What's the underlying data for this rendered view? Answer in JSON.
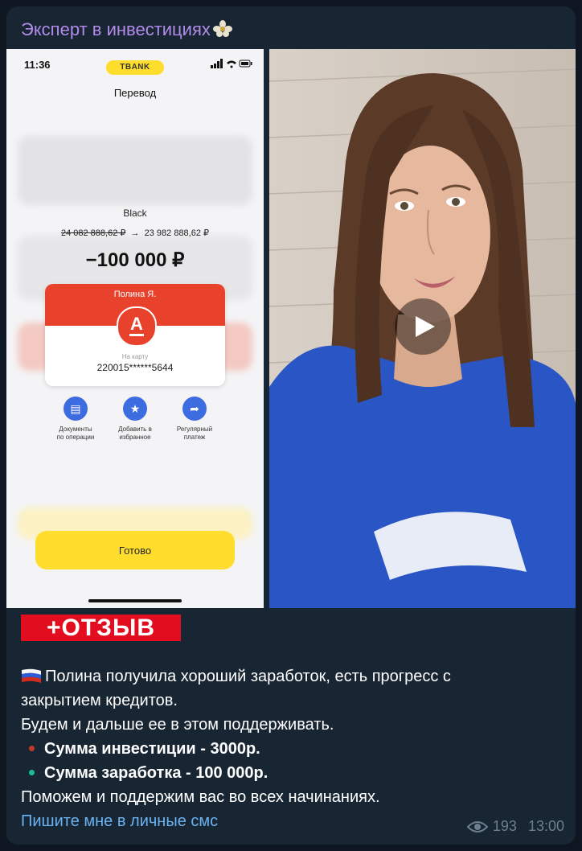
{
  "channel": {
    "name": "Эксперт в инвестициях"
  },
  "phone": {
    "status_time": "11:36",
    "bank_pill": "TBANK",
    "page_title": "Перевод",
    "account_name": "Black",
    "balance_before": "24 082 888,62 ₽",
    "arrow": "→",
    "balance_after": "23 982 888,62 ₽",
    "amount": "−100 000 ₽",
    "recipient": {
      "name": "Полина Я.",
      "bank_letter": "А",
      "card_label": "На карту",
      "card_number": "220015******5644"
    },
    "actions": [
      {
        "icon": "document-icon",
        "glyph": "▤",
        "label_line1": "Документы",
        "label_line2": "по операции"
      },
      {
        "icon": "star-icon",
        "glyph": "★",
        "label_line1": "Добавить в",
        "label_line2": "избранное"
      },
      {
        "icon": "repeat-icon",
        "glyph": "➦",
        "label_line1": "Регулярный",
        "label_line2": "платеж"
      }
    ],
    "done_label": "Готово"
  },
  "message": {
    "badge": "+ОТЗЫВ",
    "line1": "Полина получила хороший заработок, есть прогресс с",
    "line2": "закрытием кредитов.",
    "line3": "Будем и дальше ее в этом поддерживать.",
    "bullet1": "Сумма инвестиции - 3000р.",
    "bullet2": "Сумма заработка - 100 000р.",
    "line4": "Поможем и поддержим вас во всех начинаниях.",
    "link": "Пишите мне в личные смс",
    "views": "193",
    "time": "13:00"
  },
  "colors": {
    "background": "#0e1621",
    "bubble": "#182533",
    "channel_name": "#b28bea",
    "link": "#6ab3f3",
    "badge": "#e20d1e",
    "bullet1_dot": "#c0392b",
    "bullet2_dot": "#1abc9c"
  }
}
